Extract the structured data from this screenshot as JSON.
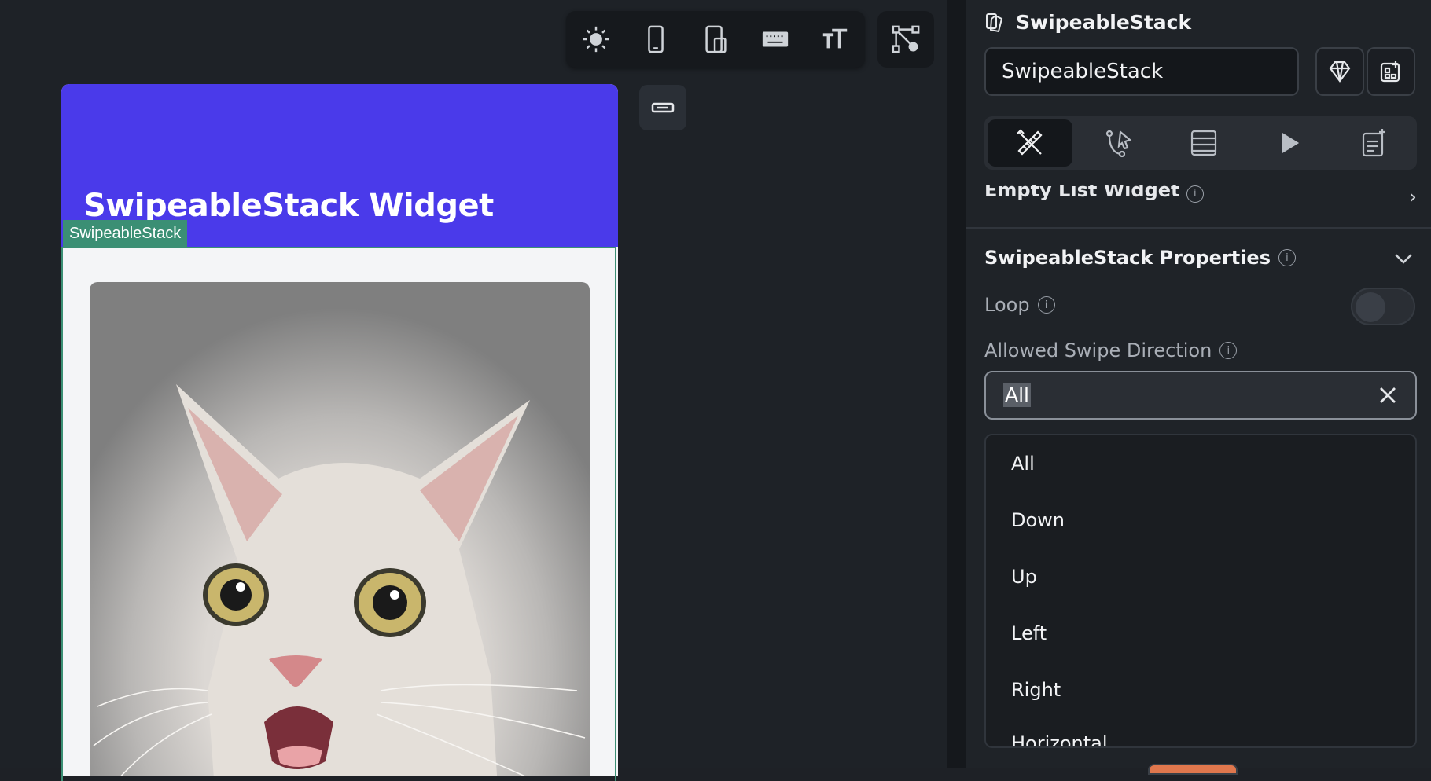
{
  "canvas": {
    "toolbar": {
      "icons": [
        "sun-icon",
        "phone-icon",
        "tablet-icon",
        "keyboard-icon",
        "text-size-icon",
        "tree-settings-icon"
      ]
    },
    "app": {
      "title": "SwipeableStack Widget",
      "selection_tag": "SwipeableStack"
    }
  },
  "panel": {
    "widget_name": "SwipeableStack",
    "name_input_value": "SwipeableStack",
    "tabs": [
      "properties-tab",
      "actions-tab",
      "backend-tab",
      "animations-tab",
      "notes-tab"
    ],
    "empty_list_row": "Empty List Widget",
    "section": {
      "title": "SwipeableStack Properties",
      "loop_label": "Loop",
      "direction_label": "Allowed Swipe Direction",
      "direction_value": "All",
      "options": [
        "All",
        "Down",
        "Up",
        "Left",
        "Right",
        "Horizontal"
      ]
    }
  },
  "colors": {
    "appbar": "#4a3aea",
    "selection": "#3b8f74",
    "panel_bg": "#1f2328"
  }
}
